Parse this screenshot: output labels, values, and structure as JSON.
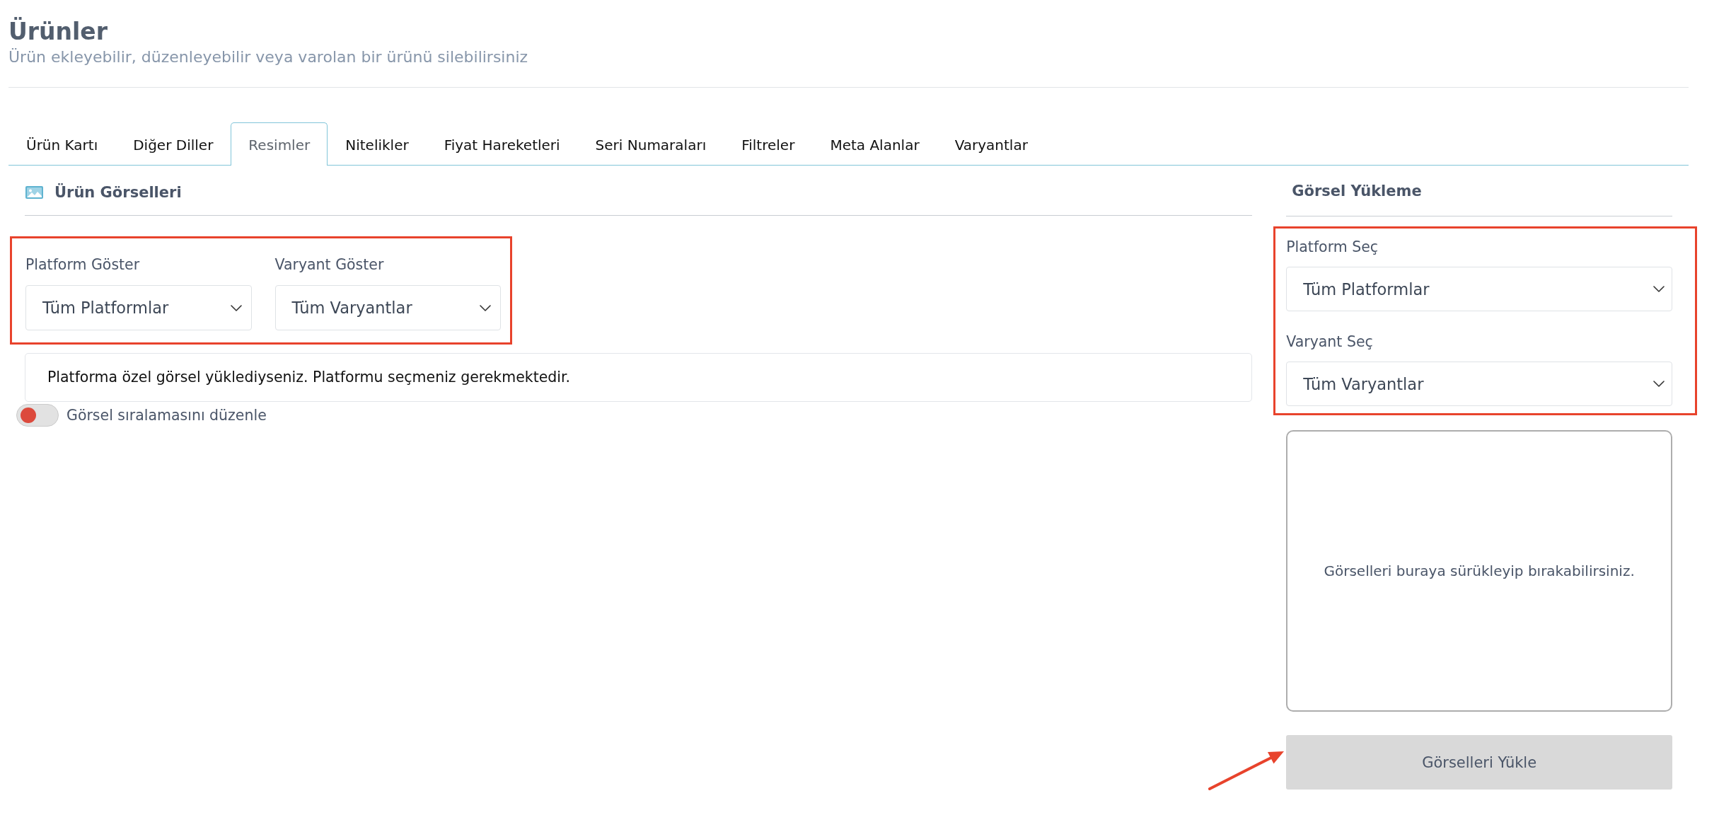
{
  "page": {
    "title": "Ürünler",
    "subtitle": "Ürün ekleyebilir, düzenleyebilir veya varolan bir ürünü silebilirsiniz"
  },
  "tabs": [
    {
      "label": "Ürün Kartı",
      "selected": false
    },
    {
      "label": "Diğer Diller",
      "selected": false
    },
    {
      "label": "Resimler",
      "selected": true
    },
    {
      "label": "Nitelikler",
      "selected": false
    },
    {
      "label": "Fiyat Hareketleri",
      "selected": false
    },
    {
      "label": "Seri Numaraları",
      "selected": false
    },
    {
      "label": "Filtreler",
      "selected": false
    },
    {
      "label": "Meta Alanlar",
      "selected": false
    },
    {
      "label": "Varyantlar",
      "selected": false
    }
  ],
  "images_panel": {
    "title": "Ürün Görselleri",
    "filters": {
      "highlighted": true,
      "fields": [
        {
          "label": "Platform Göster",
          "value": "Tüm Platformlar"
        },
        {
          "label": "Varyant Göster",
          "value": "Tüm Varyantlar"
        }
      ]
    },
    "notice": "Platforma özel görsel yüklediyseniz. Platformu seçmeniz gerekmektedir.",
    "sort_toggle": {
      "label": "Görsel sıralamasını düzenle",
      "on": false
    }
  },
  "upload_panel": {
    "title": "Görsel Yükleme",
    "filters": {
      "highlighted": true,
      "fields": [
        {
          "label": "Platform Seç",
          "value": "Tüm Platformlar"
        },
        {
          "label": "Varyant Seç",
          "value": "Tüm Varyantlar"
        }
      ]
    },
    "dropzone_text": "Görselleri buraya sürükleyip bırakabilirsiniz.",
    "upload_button": {
      "label": "Görselleri Yükle",
      "disabled": true,
      "marked_by_arrow": true
    }
  }
}
